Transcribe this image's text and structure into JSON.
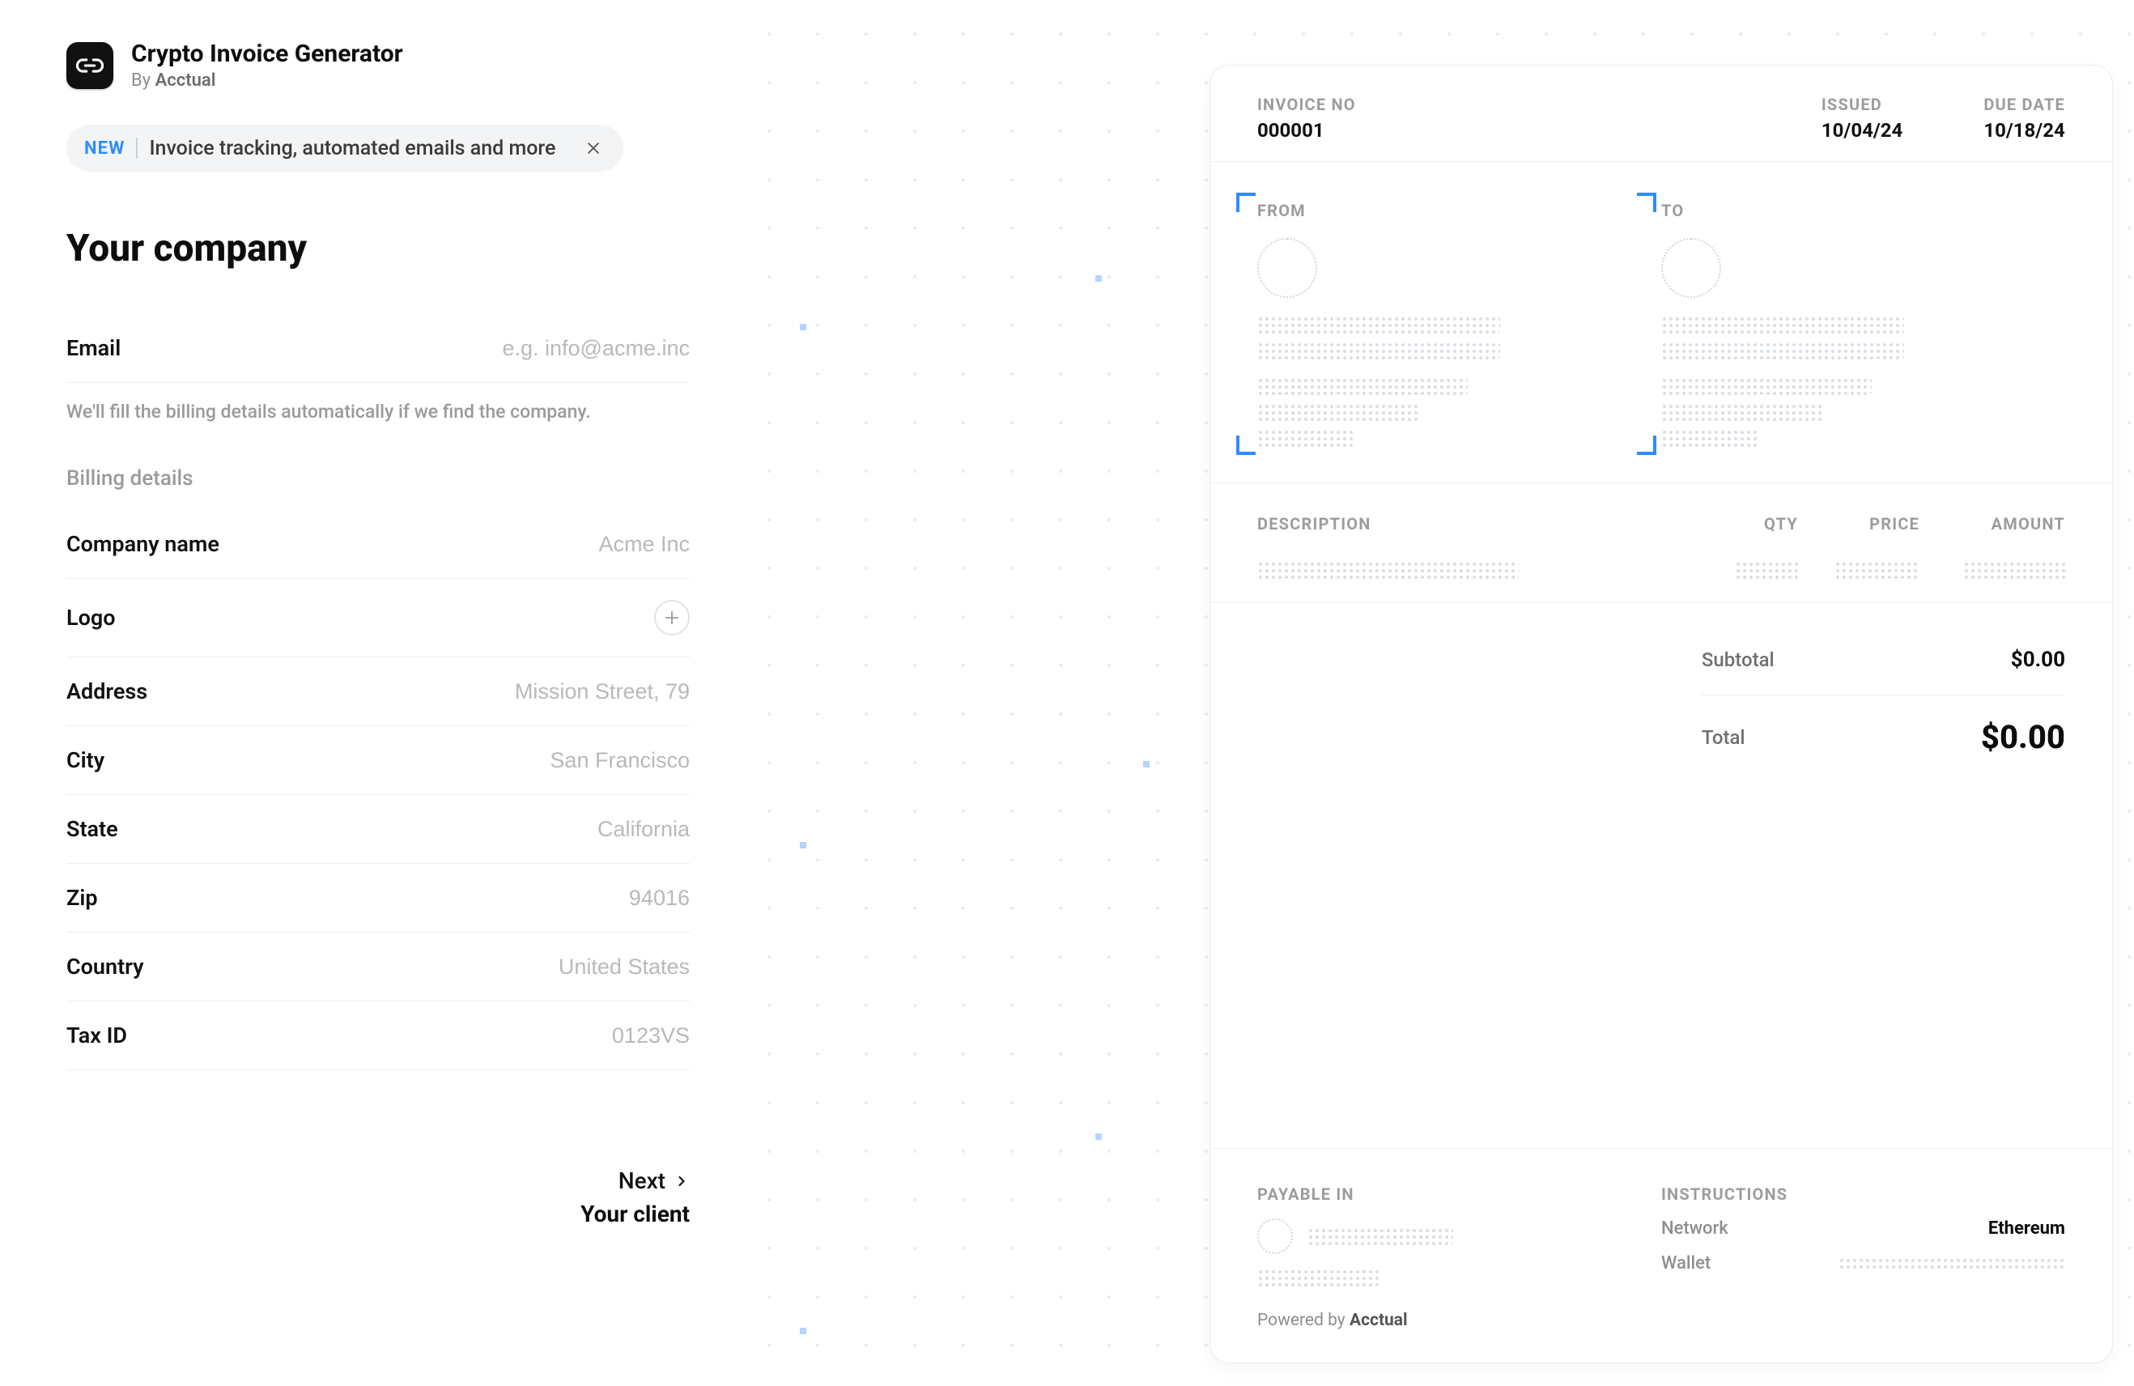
{
  "app": {
    "title": "Crypto Invoice Generator",
    "byline_prefix": "By",
    "byline_brand": "Acctual"
  },
  "promo": {
    "new_badge": "NEW",
    "text": "Invoice tracking, automated emails and more"
  },
  "form": {
    "heading": "Your company",
    "email_label": "Email",
    "email_placeholder": "e.g. info@acme.inc",
    "helper": "We'll fill the billing details automatically if we find the company.",
    "billing_heading": "Billing details",
    "fields": {
      "company_label": "Company name",
      "company_placeholder": "Acme Inc",
      "logo_label": "Logo",
      "address_label": "Address",
      "address_placeholder": "Mission Street, 79",
      "city_label": "City",
      "city_placeholder": "San Francisco",
      "state_label": "State",
      "state_placeholder": "California",
      "zip_label": "Zip",
      "zip_placeholder": "94016",
      "country_label": "Country",
      "country_placeholder": "United States",
      "taxid_label": "Tax ID",
      "taxid_placeholder": "0123VS"
    }
  },
  "nav": {
    "next_label": "Next",
    "next_sub": "Your client"
  },
  "invoice": {
    "meta": {
      "invoice_no_label": "INVOICE NO",
      "invoice_no_value": "000001",
      "issued_label": "ISSUED",
      "issued_value": "10/04/24",
      "due_label": "DUE DATE",
      "due_value": "10/18/24"
    },
    "from_label": "FROM",
    "to_label": "TO",
    "columns": {
      "description": "DESCRIPTION",
      "qty": "QTY",
      "price": "PRICE",
      "amount": "AMOUNT"
    },
    "totals": {
      "subtotal_label": "Subtotal",
      "subtotal_value": "$0.00",
      "total_label": "Total",
      "total_value": "$0.00"
    },
    "footer": {
      "payable_label": "PAYABLE IN",
      "instructions_label": "INSTRUCTIONS",
      "network_label": "Network",
      "network_value": "Ethereum",
      "wallet_label": "Wallet"
    },
    "powered_prefix": "Powered by",
    "powered_brand": "Acctual"
  }
}
